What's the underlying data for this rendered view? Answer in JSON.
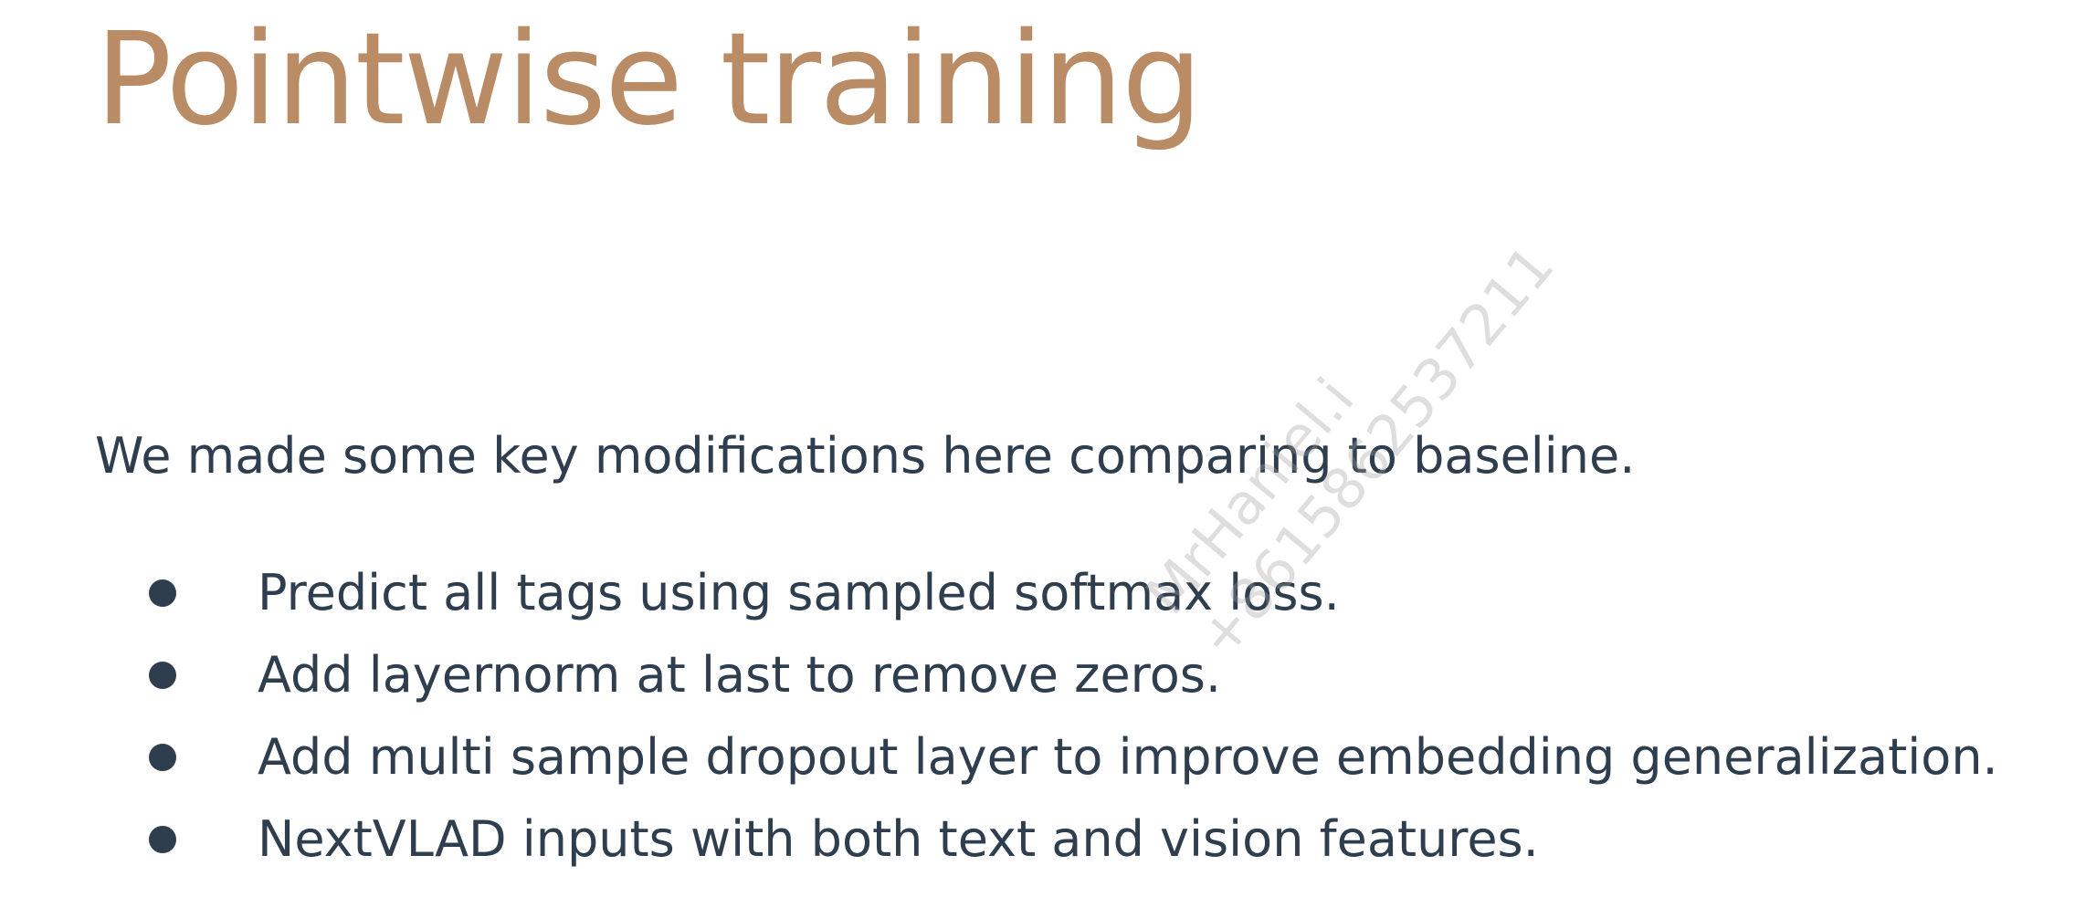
{
  "slide": {
    "title": "Pointwise training",
    "intro": "We made some key modifications here comparing to baseline.",
    "bullets": [
      "Predict all tags using sampled softmax loss.",
      "Add layernorm at last to remove zeros.",
      "Add multi sample dropout layer to improve embedding generalization.",
      "NextVLAD inputs with both text and vision features."
    ]
  },
  "watermark": {
    "line1": "MrHaniel.i",
    "line2": "+8615862537211"
  },
  "colors": {
    "title": "#b98c66",
    "text": "#2f3e4e",
    "background": "#ffffff"
  }
}
